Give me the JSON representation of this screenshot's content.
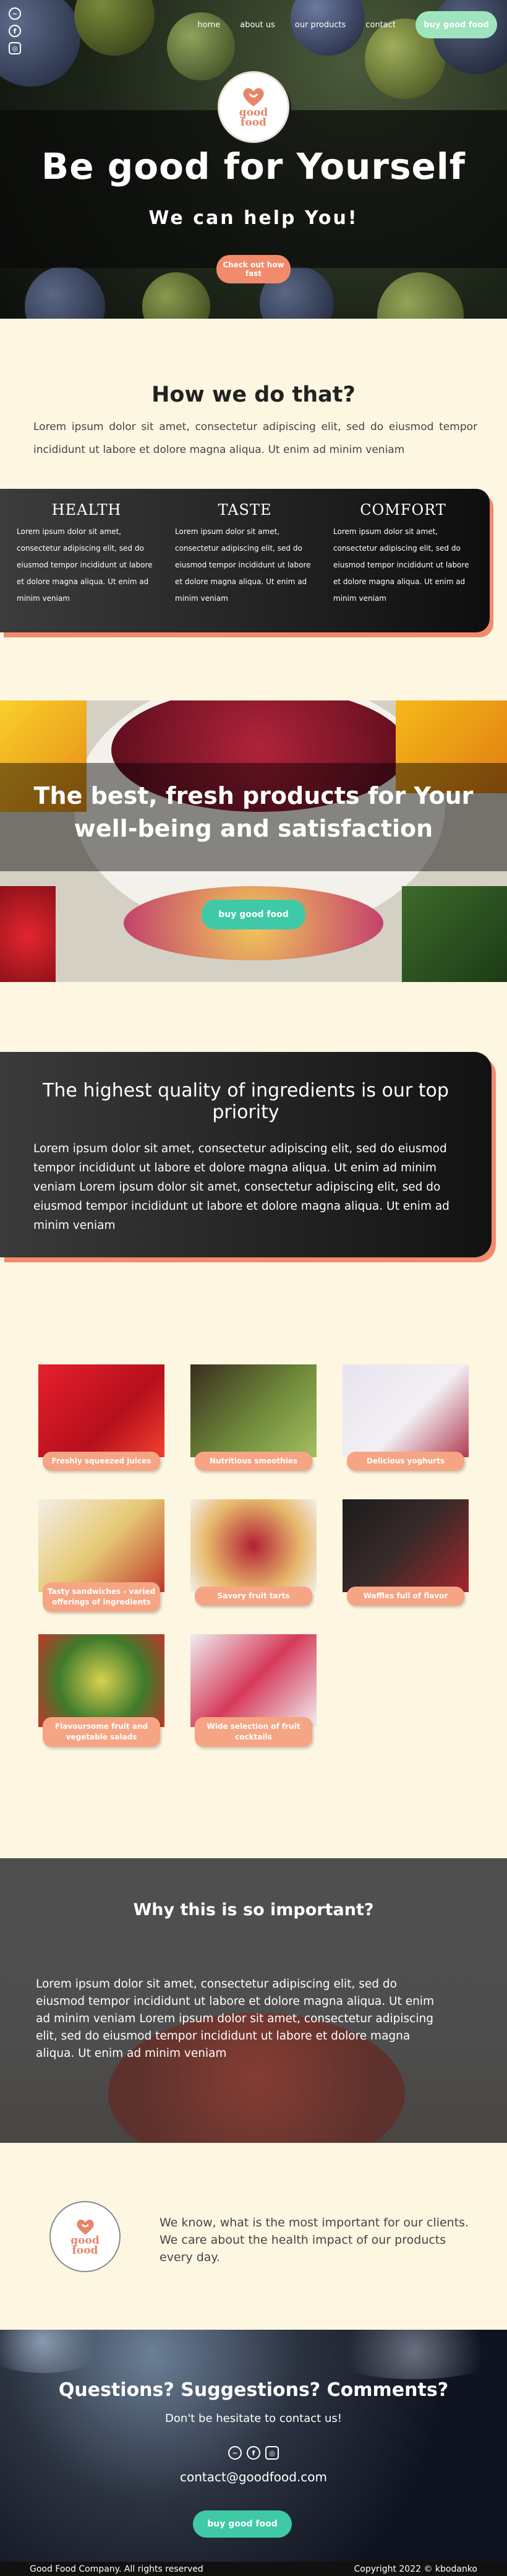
{
  "nav": {
    "items": [
      "home",
      "about us",
      "our products",
      "contact"
    ],
    "cta": "buy good food"
  },
  "social": {
    "icons": [
      "messenger-icon",
      "facebook-icon",
      "instagram-icon"
    ]
  },
  "logo": {
    "line1": "good",
    "line2": "food"
  },
  "hero": {
    "title": "Be good for Yourself",
    "subtitle": "We can help You!",
    "cta": "Check out how fast"
  },
  "how": {
    "title": "How we do that?",
    "text": "Lorem ipsum dolor sit amet, consectetur adipiscing elit, sed do eiusmod tempor incididunt ut labore et dolore magna aliqua. Ut enim ad minim veniam",
    "columns": [
      {
        "title": "HEALTH",
        "text": "Lorem ipsum dolor sit amet, consectetur adipiscing elit, sed do eiusmod tempor incididunt ut labore et dolore magna aliqua. Ut enim ad minim veniam"
      },
      {
        "title": "TASTE",
        "text": "Lorem ipsum dolor sit amet, consectetur adipiscing elit, sed do eiusmod tempor incididunt ut labore et dolore magna aliqua. Ut enim ad minim veniam"
      },
      {
        "title": "COMFORT",
        "text": "Lorem ipsum dolor sit amet, consectetur adipiscing elit, sed do eiusmod tempor incididunt ut labore et dolore magna aliqua. Ut enim ad minim veniam"
      }
    ]
  },
  "banner": {
    "title_line1": "The best, fresh products for Your",
    "title_line2": "well-being and satisfaction",
    "cta": "buy good food"
  },
  "quality": {
    "title": "The highest quality of ingredients is our top priority",
    "text": "Lorem ipsum dolor sit amet, consectetur adipiscing elit, sed do eiusmod tempor incididunt ut labore et dolore magna aliqua. Ut enim ad minim veniam Lorem ipsum dolor sit amet, consectetur adipiscing elit, sed do eiusmod tempor incididunt ut labore et dolore magna aliqua. Ut enim ad minim veniam"
  },
  "gallery": [
    {
      "label": "Freshly squeezed juices"
    },
    {
      "label": "Nutritious smoothies"
    },
    {
      "label": "Delicious yoghurts"
    },
    {
      "label": "Tasty sandwiches - varied offerings of ingredients"
    },
    {
      "label": "Savory fruit tarts"
    },
    {
      "label": "Waffles full of flavor"
    },
    {
      "label": "Flavoursome fruit and vegetable salads"
    },
    {
      "label": "Wide selection of fruit cocktails"
    }
  ],
  "why": {
    "title": "Why this is so important?",
    "text": "Lorem ipsum dolor sit amet, consectetur adipiscing elit, sed do eiusmod tempor incididunt ut labore et dolore magna aliqua. Ut enim ad minim veniam Lorem ipsum dolor sit amet, consectetur adipiscing elit, sed do eiusmod tempor incididunt ut labore et dolore magna aliqua. Ut enim ad minim veniam"
  },
  "about": {
    "text": "We know, what is the most important for our clients. We care about the health impact of our products every day."
  },
  "contact": {
    "title": "Questions? Suggestions? Comments?",
    "subtitle": "Don't be hesitate to contact us!",
    "email": "contact@goodfood.com",
    "cta": "buy good food"
  },
  "footer": {
    "left": "Good Food Company. All rights reserved",
    "right": "Copyright 2022 © kbodanko"
  },
  "colors": {
    "accent_orange": "#f28b6b",
    "accent_green": "#40c9a6",
    "cream": "#fdf6e1"
  }
}
